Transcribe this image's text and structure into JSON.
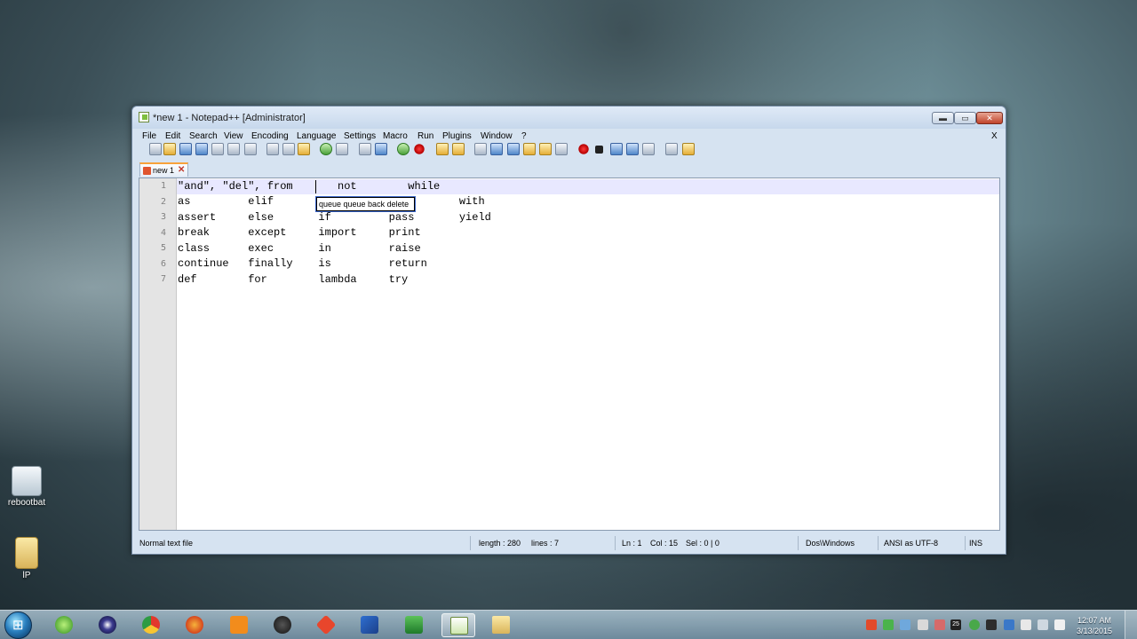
{
  "window": {
    "title": "*new 1 - Notepad++ [Administrator]",
    "min_glyph": "▬",
    "max_glyph": "▭",
    "close_glyph": "✕"
  },
  "menu": {
    "items": [
      "File",
      "Edit",
      "Search",
      "View",
      "Encoding",
      "Language",
      "Settings",
      "Macro",
      "Run",
      "Plugins",
      "Window",
      "?"
    ],
    "close_doc": "X"
  },
  "tab": {
    "label": "new 1",
    "close_glyph": "✕"
  },
  "editor": {
    "lines": [
      {
        "no": "1",
        "text": "\"and\", \"del\", from       not        while"
      },
      {
        "no": "2",
        "text": "as         elif       global     or         with"
      },
      {
        "no": "3",
        "text": "assert     else       if         pass       yield"
      },
      {
        "no": "4",
        "text": "break      except     import     print"
      },
      {
        "no": "5",
        "text": "class      exec       in         raise"
      },
      {
        "no": "6",
        "text": "continue   finally    is         return"
      },
      {
        "no": "7",
        "text": "def        for        lambda     try"
      }
    ],
    "tooltip": "queue queue back delete"
  },
  "status": {
    "file_type": "Normal text file",
    "length": "length : 280",
    "lines": "lines : 7",
    "ln": "Ln : 1",
    "col": "Col : 15",
    "sel": "Sel : 0 | 0",
    "eol": "Dos\\Windows",
    "encoding": "ANSI as UTF-8",
    "mode": "INS"
  },
  "desktop": {
    "icons": [
      {
        "label": "rebootbat"
      },
      {
        "label": "lP"
      }
    ]
  },
  "taskbar": {
    "clock_time": "12:07 AM",
    "clock_date": "3/13/2015",
    "tray_badge": "25"
  }
}
